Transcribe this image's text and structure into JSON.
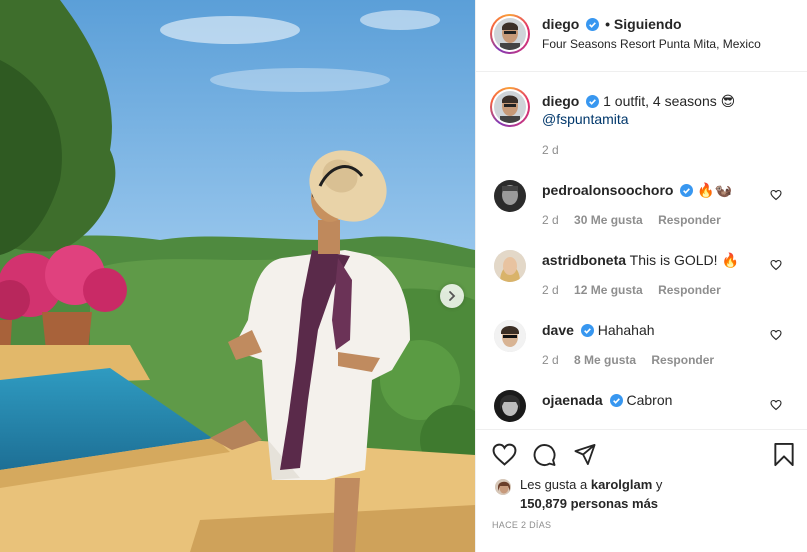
{
  "post": {
    "author": {
      "username": "diego",
      "verified": true,
      "follow_separator": "•",
      "follow_status": "Siguiendo"
    },
    "location": "Four Seasons Resort Punta Mita, Mexico",
    "caption": {
      "username": "diego",
      "text": "1 outfit, 4 seasons 😎",
      "mention": "@fspuntamita",
      "time": "2 d"
    },
    "comments": [
      {
        "username": "pedroalonsoochoro",
        "verified": true,
        "text": "🔥🦦",
        "time": "2 d",
        "likes": "30 Me gusta",
        "reply": "Responder"
      },
      {
        "username": "astridboneta",
        "verified": false,
        "text": "This is GOLD! 🔥",
        "time": "2 d",
        "likes": "12 Me gusta",
        "reply": "Responder"
      },
      {
        "username": "dave",
        "verified": true,
        "text": "Hahahah",
        "time": "2 d",
        "likes": "8 Me gusta",
        "reply": "Responder"
      },
      {
        "username": "ojaenada",
        "verified": true,
        "text": "Cabron",
        "time": "",
        "likes": "",
        "reply": ""
      }
    ],
    "likes_line1": "Les gusta a",
    "likes_user": "karolglam",
    "likes_and": "y",
    "likes_count": "150,879 personas más",
    "posted_ago": "HACE 2 DÍAS"
  },
  "icons": {
    "like": "heart-icon",
    "comment": "comment-icon",
    "share": "paper-plane-icon",
    "save": "bookmark-icon",
    "next": "chevron-right-icon",
    "verified": "verified-badge-icon"
  },
  "colors": {
    "verified": "#3897f0",
    "text": "#262626",
    "muted": "#8e8e8e",
    "mention": "#00376b"
  }
}
